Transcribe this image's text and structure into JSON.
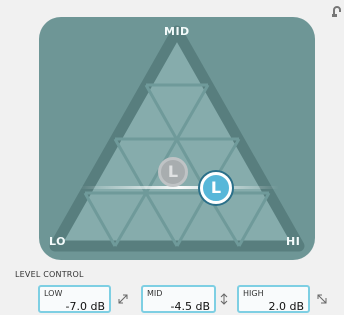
{
  "triangle": {
    "labels": {
      "mid": "MID",
      "lo": "LO",
      "hi": "HI"
    },
    "handles": {
      "active": "L",
      "ghost": "L"
    }
  },
  "level_control": {
    "title": "LEVEL CONTROL",
    "fields": [
      {
        "label": "LOW",
        "value": "-7.0 dB",
        "icon": "diagonal-arrows-icon"
      },
      {
        "label": "MID",
        "value": "-4.5 dB",
        "icon": "vertical-arrows-icon"
      },
      {
        "label": "HIGH",
        "value": "2.0 dB",
        "icon": "diagonal-corner-arrow-icon"
      }
    ]
  },
  "colors": {
    "panel": "#6e9696",
    "triangle_fill": "#86acac",
    "triangle_edge": "#587e7e",
    "accent": "#57b7d9",
    "field_border": "#7ecfe3"
  },
  "icons": {
    "top_right": "link-icon"
  }
}
